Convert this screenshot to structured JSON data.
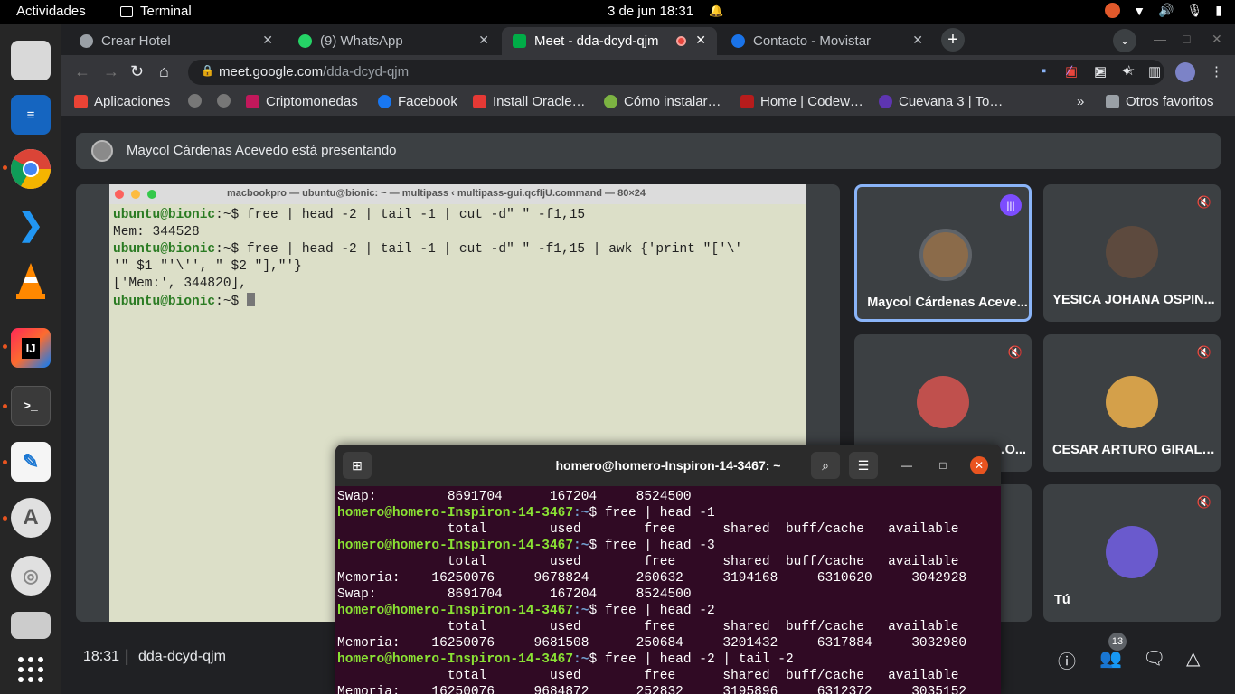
{
  "topbar": {
    "activities": "Actividades",
    "app": "Terminal",
    "clock": "3 de jun  18:31"
  },
  "dock": {
    "items": [
      "files-icon",
      "writer-icon",
      "chrome-icon",
      "vscode-icon",
      "vlc-icon",
      "intellij-icon",
      "terminal-icon",
      "text-editor-icon",
      "software-icon",
      "disc-icon",
      "drive-icon",
      "apps-grid-icon"
    ]
  },
  "tabs": [
    {
      "label": "Crear Hotel",
      "color": "#9aa0a6"
    },
    {
      "label": "(9) WhatsApp",
      "color": "#25d366"
    },
    {
      "label": "Meet - dda-dcyd-qjm",
      "color": "#00ac47"
    },
    {
      "label": "Contacto - Movistar",
      "color": "#1a73e8"
    }
  ],
  "omnibox": {
    "domain": "meet.google.com",
    "path": "/dda-dcyd-qjm"
  },
  "bookmarks": [
    {
      "label": "Aplicaciones",
      "color": "#ea4335"
    },
    {
      "label": "",
      "color": "#777777"
    },
    {
      "label": "",
      "color": "#777777"
    },
    {
      "label": "Criptomonedas",
      "color": "#c2185b"
    },
    {
      "label": "Facebook",
      "color": "#1877f2"
    },
    {
      "label": "Install Oracle…",
      "color": "#e53935"
    },
    {
      "label": "Cómo instalar…",
      "color": "#7cb342"
    },
    {
      "label": "Home | Codew…",
      "color": "#b71c1c"
    },
    {
      "label": "Cuevana 3 | To…",
      "color": "#5e35b1"
    }
  ],
  "bookmarks_more": "»",
  "bookmarks_other": "Otros favoritos",
  "meet": {
    "presenting": "Maycol Cárdenas Acevedo está presentando",
    "shared_title": "macbookpro — ubuntu@bionic: ~ — multipass ‹ multipass-gui.qcfIjU.command — 80×24",
    "shared_lines": [
      {
        "prompt": "ubuntu@bionic",
        "rest": ":~$ free | head -2 | tail -1 | cut -d\" \" -f1,15"
      },
      {
        "prompt": "",
        "rest": "Mem: 344528"
      },
      {
        "prompt": "ubuntu@bionic",
        "rest": ":~$ free | head -2 | tail -1 | cut -d\" \" -f1,15 | awk {'print \"['\\'"
      },
      {
        "prompt": "",
        "rest": "'\" $1 \"'\\'', \" $2 \"],\"'}"
      },
      {
        "prompt": "",
        "rest": "['Mem:', 344820],"
      },
      {
        "prompt": "ubuntu@bionic",
        "rest": ":~$ "
      }
    ],
    "participants": [
      {
        "name": "Maycol Cárdenas Aceve...",
        "avatar_color": "#8b6b4a"
      },
      {
        "name": "YESICA JOHANA OSPIN...",
        "avatar_color": "#5d4a3e"
      },
      {
        "name": "…O...",
        "avatar_color": "#c0504d"
      },
      {
        "name": "CESAR ARTURO GIRALD...",
        "avatar_color": "#d4a04a"
      },
      {
        "name": "Tú",
        "avatar_color": "#6a5acd"
      }
    ],
    "time": "18:31",
    "code": "dda-dcyd-qjm",
    "people_count": "13"
  },
  "terminal": {
    "title": "homero@homero-Inspiron-14-3467: ~",
    "prompt": "homero@homero-Inspiron-14-3467",
    "lines": [
      {
        "p": "",
        "t": "Swap:         8691704      167204     8524500"
      },
      {
        "p": "homero@homero-Inspiron-14-3467",
        "t": "$ free | head -1"
      },
      {
        "p": "",
        "t": "              total        used        free      shared  buff/cache   available"
      },
      {
        "p": "homero@homero-Inspiron-14-3467",
        "t": "$ free | head -3"
      },
      {
        "p": "",
        "t": "              total        used        free      shared  buff/cache   available"
      },
      {
        "p": "",
        "t": "Memoria:    16250076     9678824      260632     3194168     6310620     3042928"
      },
      {
        "p": "",
        "t": "Swap:         8691704      167204     8524500"
      },
      {
        "p": "homero@homero-Inspiron-14-3467",
        "t": "$ free | head -2"
      },
      {
        "p": "",
        "t": "              total        used        free      shared  buff/cache   available"
      },
      {
        "p": "",
        "t": "Memoria:    16250076     9681508      250684     3201432     6317884     3032980"
      },
      {
        "p": "homero@homero-Inspiron-14-3467",
        "t": "$ free | head -2 | tail -2"
      },
      {
        "p": "",
        "t": "              total        used        free      shared  buff/cache   available"
      },
      {
        "p": "",
        "t": "Memoria:    16250076     9684872      252832     3195896     6312372     3035152"
      }
    ]
  }
}
